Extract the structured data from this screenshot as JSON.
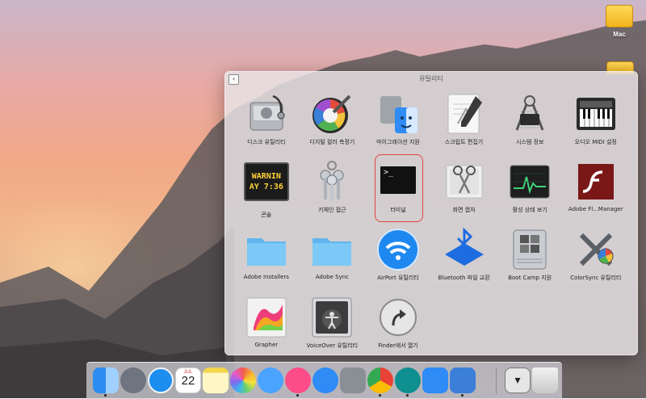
{
  "desktop": {
    "drive_label": "Mac"
  },
  "launchpad": {
    "title": "유틸리티",
    "back_glyph": "‹",
    "apps": [
      {
        "label": "디스크 유틸리티",
        "icon": "disk-utility-icon"
      },
      {
        "label": "디지털 컬러 측정기",
        "icon": "digital-color-meter-icon"
      },
      {
        "label": "마이그레이션 지원",
        "icon": "migration-assistant-icon"
      },
      {
        "label": "스크립트 편집기",
        "icon": "script-editor-icon"
      },
      {
        "label": "시스템 정보",
        "icon": "system-information-icon"
      },
      {
        "label": "오디오 MIDI 설정",
        "icon": "audio-midi-setup-icon"
      },
      {
        "label": "콘솔",
        "icon": "console-icon",
        "icon_text": [
          "WARNIN",
          "AY 7:36"
        ]
      },
      {
        "label": "키체인 접근",
        "icon": "keychain-access-icon"
      },
      {
        "label": "터미널",
        "icon": "terminal-icon",
        "icon_text": ">_",
        "selected": true
      },
      {
        "label": "화면 캡처",
        "icon": "screenshot-icon"
      },
      {
        "label": "활성 상태 보기",
        "icon": "activity-monitor-icon"
      },
      {
        "label": "Adobe Fl...Manager",
        "icon": "adobe-flash-icon"
      },
      {
        "label": "Adobe Installers",
        "icon": "folder-icon"
      },
      {
        "label": "Adobe Sync",
        "icon": "folder-icon"
      },
      {
        "label": "AirPort 유틸리티",
        "icon": "airport-utility-icon"
      },
      {
        "label": "Bluetooth 파일 교환",
        "icon": "bluetooth-file-exchange-icon"
      },
      {
        "label": "Boot Camp 지원",
        "icon": "boot-camp-icon"
      },
      {
        "label": "ColorSync 유틸리티",
        "icon": "colorsync-utility-icon"
      },
      {
        "label": "Grapher",
        "icon": "grapher-icon"
      },
      {
        "label": "VoiceOver 유틸리티",
        "icon": "voiceover-utility-icon"
      },
      {
        "label": "Finder에서 열기",
        "icon": "open-in-finder-icon"
      }
    ]
  },
  "dock": {
    "calendar_month": "JUL",
    "calendar_day": "22",
    "items": [
      {
        "name": "finder",
        "color": "#2d8cf0"
      },
      {
        "name": "launchpad",
        "color": "#6f7580"
      },
      {
        "name": "safari",
        "color": "#1b8ef0"
      },
      {
        "name": "calendar",
        "color": "#ffffff"
      },
      {
        "name": "notes",
        "color": "#ffe870"
      },
      {
        "name": "photos",
        "color": "#ffffff"
      },
      {
        "name": "messages",
        "color": "#4aa3ff"
      },
      {
        "name": "itunes",
        "color": "#fd4d88"
      },
      {
        "name": "app-store",
        "color": "#2f8bf5"
      },
      {
        "name": "system-preferences",
        "color": "#8a8f96"
      },
      {
        "name": "chrome",
        "color": "#ffffff"
      },
      {
        "name": "app-a",
        "color": "#0f8f8f"
      },
      {
        "name": "icloud",
        "color": "#2f8bf5"
      },
      {
        "name": "keynote",
        "color": "#3b7fd9"
      },
      {
        "name": "downloads",
        "color": "#e6e6e6"
      },
      {
        "name": "trash",
        "color": "#d9d9d9"
      }
    ]
  }
}
